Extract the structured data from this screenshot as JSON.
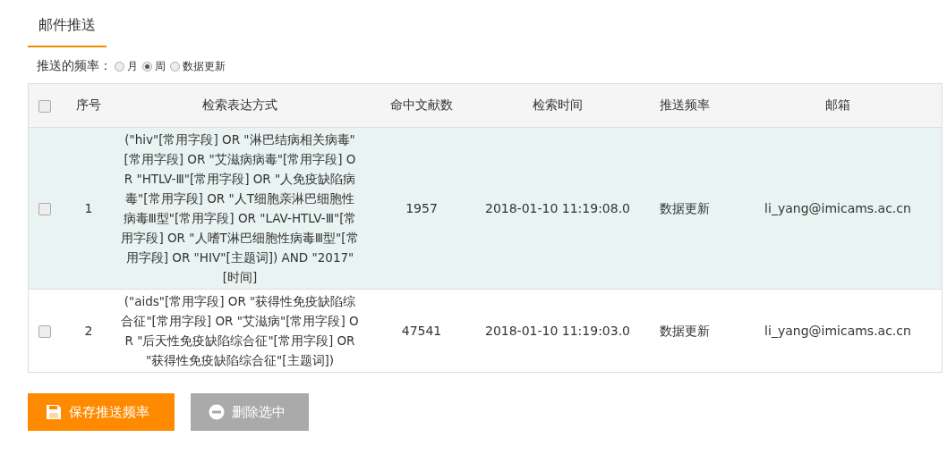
{
  "tabs": [
    {
      "label": "邮件推送",
      "selected": true
    }
  ],
  "frequency": {
    "label": "推送的频率：",
    "options": [
      {
        "label": "月",
        "selected": false
      },
      {
        "label": "周",
        "selected": true
      },
      {
        "label": "数据更新",
        "selected": false
      }
    ]
  },
  "table": {
    "select_all_checked": false,
    "columns": [
      "序号",
      "检索表达方式",
      "命中文献数",
      "检索时间",
      "推送频率",
      "邮箱"
    ],
    "rows": [
      {
        "checked": false,
        "highlighted": true,
        "cells": [
          "1",
          "(\"hiv\"[常用字段] OR \"淋巴结病相关病毒\"[常用字段] OR \"艾滋病病毒\"[常用字段] OR \"HTLV-Ⅲ\"[常用字段] OR \"人免疫缺陷病毒\"[常用字段] OR \"人T细胞亲淋巴细胞性病毒Ⅲ型\"[常用字段] OR \"LAV-HTLV-Ⅲ\"[常用字段] OR \"人嗜T淋巴细胞性病毒Ⅲ型\"[常用字段] OR \"HIV\"[主题词]) AND \"2017\"[时间]",
          "1957",
          "2018-01-10 11:19:08.0",
          "数据更新",
          "li_yang@imicams.ac.cn"
        ]
      },
      {
        "checked": false,
        "highlighted": false,
        "cells": [
          "2",
          "(\"aids\"[常用字段] OR \"获得性免疫缺陷综合征\"[常用字段] OR \"艾滋病\"[常用字段] OR \"后天性免疫缺陷综合征\"[常用字段] OR \"获得性免疫缺陷综合征\"[主题词])",
          "47541",
          "2018-01-10 11:19:03.0",
          "数据更新",
          "li_yang@imicams.ac.cn"
        ]
      }
    ]
  },
  "buttons": [
    {
      "kind": "save",
      "label": "保存推送频率"
    },
    {
      "kind": "delete",
      "label": "删除选中"
    }
  ]
}
